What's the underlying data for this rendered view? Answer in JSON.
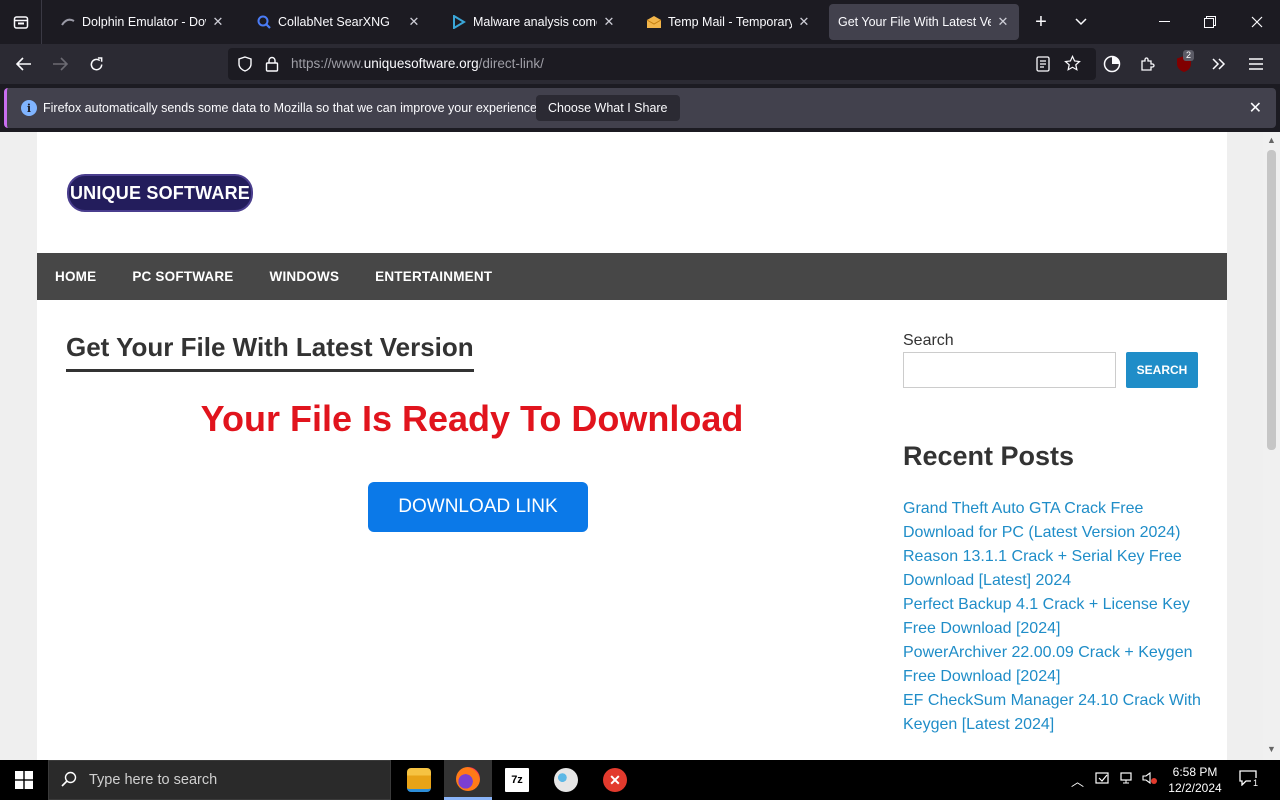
{
  "browser": {
    "tabs": [
      {
        "title": "Dolphin Emulator - Down",
        "icon": "dolphin-icon",
        "active": false
      },
      {
        "title": "CollabNet SearXNG",
        "icon": "searxng-icon",
        "active": false
      },
      {
        "title": "Malware analysis comedi",
        "icon": "malware-site-icon",
        "active": false
      },
      {
        "title": "Temp Mail - Temporary Di",
        "icon": "tempmail-icon",
        "active": false
      },
      {
        "title": "Get Your File With Latest Versi",
        "icon": "",
        "active": true
      }
    ],
    "url_prefix": "https://www.",
    "url_domain": "uniquesoftware.org",
    "url_path": "/direct-link/",
    "extension_badge": "2",
    "notification": {
      "message": "Firefox automatically sends some data to Mozilla so that we can improve your experience.",
      "button": "Choose What I Share"
    }
  },
  "site": {
    "logo_text": "UNIQUE SOFTWARE",
    "menu": [
      "HOME",
      "PC SOFTWARE",
      "WINDOWS",
      "ENTERTAINMENT"
    ],
    "post_title": "Get Your File With Latest Version",
    "ready_text": "Your File Is Ready To Download",
    "download_button": "DOWNLOAD LINK",
    "sidebar": {
      "search_label": "Search",
      "search_button": "SEARCH",
      "recent_title": "Recent Posts",
      "recent_posts": [
        "Grand Theft Auto GTA Crack Free Download for PC (Latest Version 2024)",
        "Reason 13.1.1 Crack + Serial Key Free Download [Latest] 2024",
        "Perfect Backup 4.1 Crack + License Key Free Download [2024]",
        "PowerArchiver 22.00.09 Crack + Keygen Free Download [2024]",
        "EF CheckSum Manager 24.10 Crack With Keygen [Latest 2024]"
      ]
    },
    "colors": {
      "ready": "#e1141d",
      "download": "#0b79e8",
      "links": "#1f8dc8",
      "menu_bar": "#474747"
    }
  },
  "taskbar": {
    "search_placeholder": "Type here to search",
    "time": "6:58 PM",
    "date": "12/2/2024",
    "notification_count": "1",
    "apps": [
      "file-explorer-icon",
      "firefox-icon",
      "7zip-icon",
      "paint-app-icon",
      "red-x-app-icon"
    ]
  }
}
